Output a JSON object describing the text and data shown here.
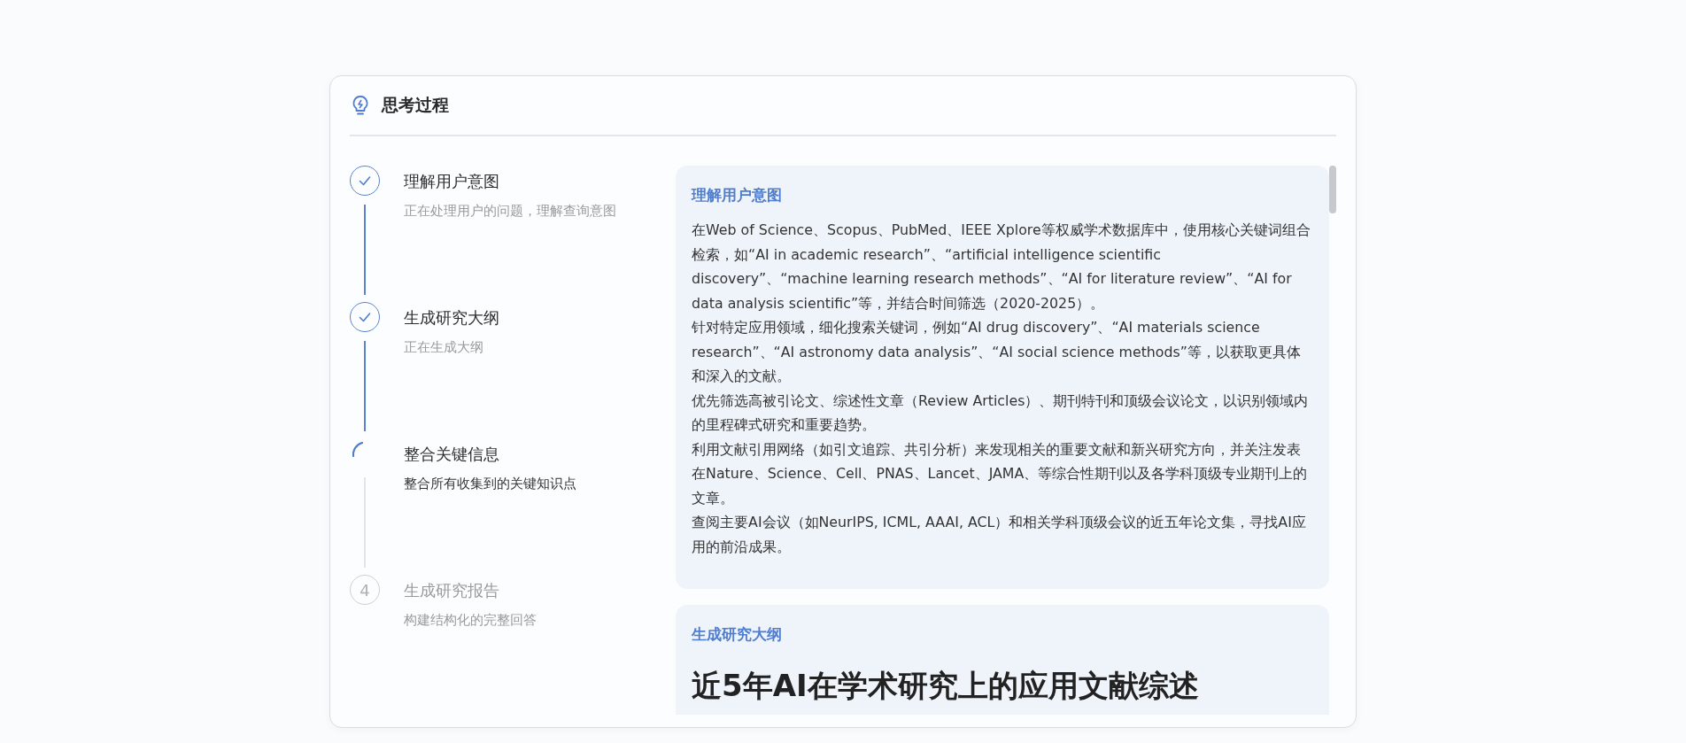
{
  "panel": {
    "title": "思考过程"
  },
  "steps": [
    {
      "title": "理解用户意图",
      "description": "正在处理用户的问题，理解查询意图",
      "kind": "done"
    },
    {
      "title": "生成研究大纲",
      "description": "正在生成大纲",
      "kind": "done"
    },
    {
      "title": "整合关键信息",
      "description": "整合所有收集到的关键知识点",
      "kind": "active"
    },
    {
      "title": "生成研究报告",
      "description": "构建结构化的完整回答",
      "kind": "pending",
      "number": "4"
    }
  ],
  "sections": [
    {
      "title": "理解用户意图",
      "paragraphs": [
        "在Web of Science、Scopus、PubMed、IEEE Xplore等权威学术数据库中，使用核心关键词组合检索，如“AI in academic research”、“artificial intelligence scientific discovery”、“machine learning research methods”、“AI for literature review”、“AI for data analysis scientific”等，并结合时间筛选（2020-2025）。",
        "针对特定应用领域，细化搜索关键词，例如“AI drug discovery”、“AI materials science research”、“AI astronomy data analysis”、“AI social science methods”等，以获取更具体和深入的文献。",
        "优先筛选高被引论文、综述性文章（Review Articles）、期刊特刊和顶级会议论文，以识别领域内的里程碑式研究和重要趋势。",
        "利用文献引用网络（如引文追踪、共引分析）来发现相关的重要文献和新兴研究方向，并关注发表在Nature、Science、Cell、PNAS、Lancet、JAMA、等综合性期刊以及各学科顶级专业期刊上的文章。",
        "查阅主要AI会议（如NeurIPS, ICML, AAAI, ACL）和相关学科顶级会议的近五年论文集，寻找AI应用的前沿成果。"
      ]
    },
    {
      "title": "生成研究大纲",
      "heading": "近5年AI在学术研究上的应用文献综述"
    }
  ]
}
